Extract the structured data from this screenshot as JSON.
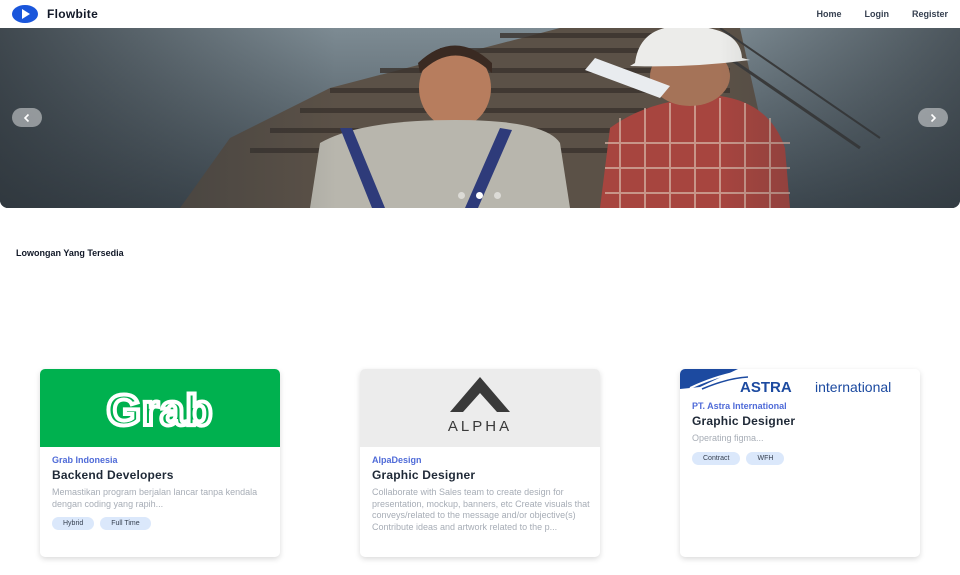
{
  "navbar": {
    "brand": "Flowbite",
    "links": [
      "Home",
      "Login",
      "Register"
    ]
  },
  "carousel": {
    "prev_icon": "chevron-left-icon",
    "next_icon": "chevron-right-icon",
    "slide_count": 3,
    "active_slide": 2
  },
  "section": {
    "title": "Lowongan Yang Tersedia"
  },
  "jobs": [
    {
      "logo_text": "Grab",
      "company": "Grab Indonesia",
      "title": "Backend Developers",
      "description": "Memastikan program berjalan lancar tanpa kendala dengan coding yang rapih...",
      "tags": [
        "Hybrid",
        "Full Time"
      ]
    },
    {
      "logo_text": "ALPHA",
      "company": "AlpaDesign",
      "title": "Graphic Designer",
      "description": "Collaborate with Sales team to create design for presentation, mockup, banners, etc Create visuals that conveys/related to the message and/or objective(s) Contribute ideas and artwork related to the p...",
      "tags": []
    },
    {
      "logo_text": "ASTRA international",
      "company": "PT. Astra International",
      "title": "Graphic Designer",
      "description": "Operating figma...",
      "tags": [
        "Contract",
        "WFH"
      ]
    }
  ],
  "colors": {
    "accent": "#1a56db",
    "company_text": "#4f6bd8",
    "grab_green": "#00b14f",
    "tag_bg": "#dbe8fb",
    "astra_blue": "#1c4aa0"
  }
}
